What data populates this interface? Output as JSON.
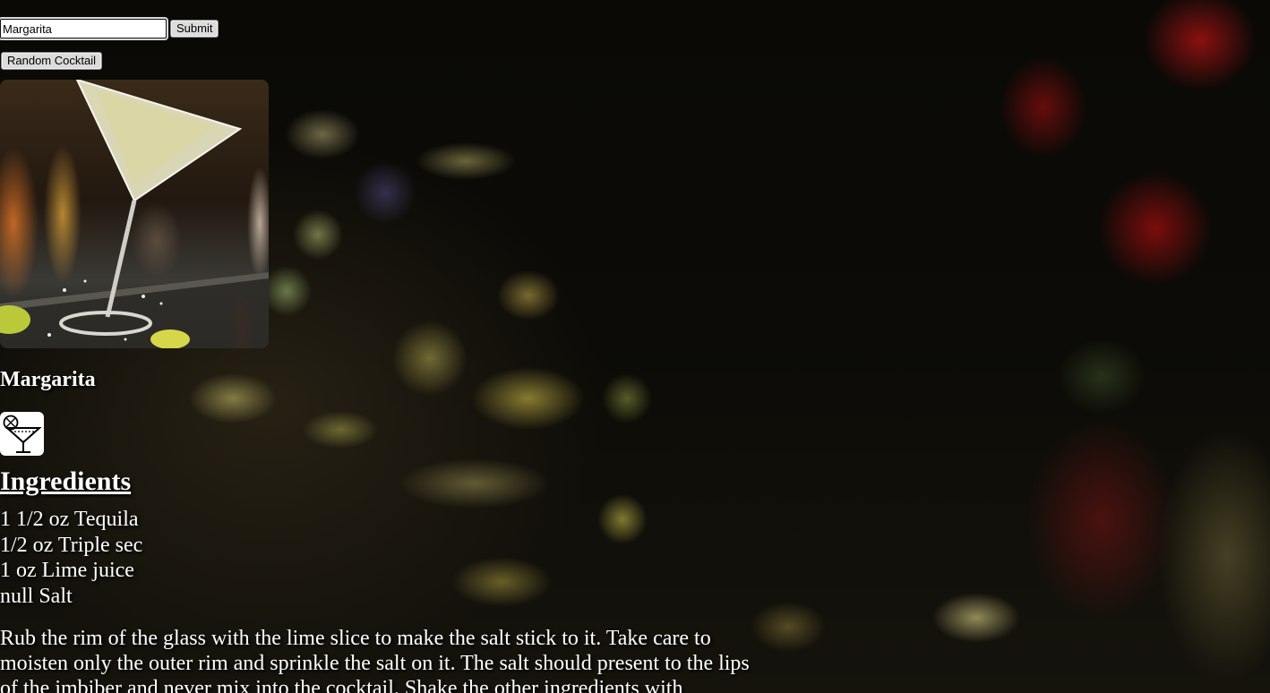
{
  "search": {
    "value": "Margarita",
    "submit_label": "Submit"
  },
  "random_button_label": "Random Cocktail",
  "drink": {
    "name": "Margarita",
    "image_icon": "cocktail-photo",
    "glass_icon": "martini-glass-icon",
    "ingredients_heading": "Ingredients",
    "ingredients": [
      "1 1/2 oz Tequila",
      "1/2 oz Triple sec",
      "1 oz Lime juice",
      "null Salt"
    ],
    "instructions": "Rub the rim of the glass with the lime slice to make the salt stick to it. Take care to moisten only the outer rim and sprinkle the salt on it. The salt should present to the lips of the imbiber and never mix into the cocktail. Shake the other ingredients with"
  },
  "colors": {
    "text": "#ffffff",
    "button_bg": "#dcdcdc",
    "page_bg": "#050403"
  }
}
